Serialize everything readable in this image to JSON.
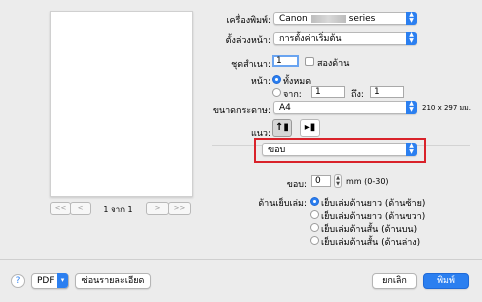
{
  "printer": {
    "label": "เครื่องพิมพ์:",
    "value_prefix": "Canon",
    "value_suffix": "series"
  },
  "presets": {
    "label": "ตั้งล่วงหน้า:",
    "value": "การตั้งค่าเริ่มต้น"
  },
  "copies": {
    "label": "ชุดสำเนา:",
    "value": "1",
    "two_sided_label": "สองด้าน"
  },
  "pages": {
    "label": "หน้า:",
    "all_label": "ทั้งหมด",
    "from_label": "จาก:",
    "from_value": "1",
    "to_label": "ถึง:",
    "to_value": "1"
  },
  "paper_size": {
    "label": "ขนาดกระดาษ:",
    "value": "A4",
    "dimensions": "210 x 297 มม."
  },
  "orientation": {
    "label": "แนว:"
  },
  "section_popup": {
    "value": "ขอบ"
  },
  "margin": {
    "label": "ขอบ:",
    "value": "0",
    "unit_range": "mm (0-30)"
  },
  "stapling": {
    "label": "ด้านเย็บเล่ม:",
    "options": [
      "เย็บเล่มด้านยาว (ด้านซ้าย)",
      "เย็บเล่มด้านยาว (ด้านขวา)",
      "เย็บเล่มด้านสั้น (ด้านบน)",
      "เย็บเล่มด้านสั้น (ด้านล่าง)"
    ],
    "selected_index": 0
  },
  "preview_pager": {
    "info": "1 จาก 1",
    "first": "<<",
    "prev": "<",
    "next": ">",
    "last": ">>"
  },
  "bottom": {
    "help": "?",
    "pdf_label": "PDF",
    "hide_details_label": "ซ่อนรายละเอียด",
    "cancel_label": "ยกเลิก",
    "print_label": "พิมพ์"
  },
  "colors": {
    "accent": "#2b7ff0",
    "highlight": "#d9222a"
  }
}
